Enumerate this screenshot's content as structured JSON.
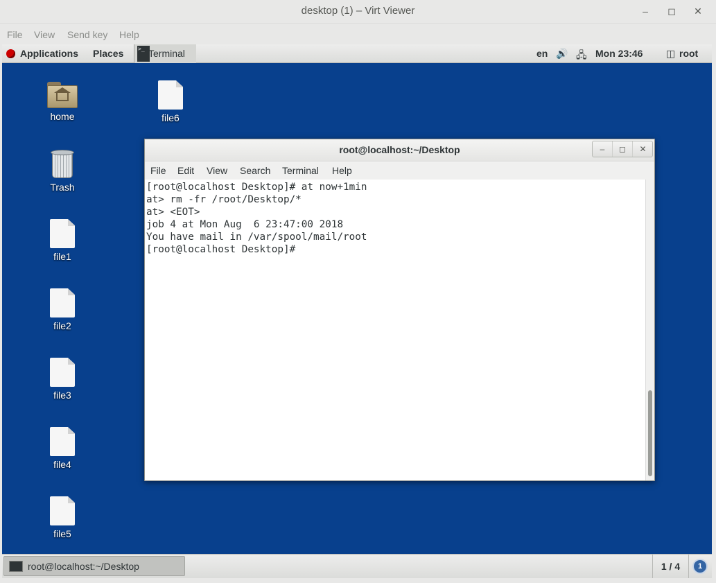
{
  "viewer": {
    "title": "desktop (1) – Virt Viewer",
    "menu": [
      "File",
      "View",
      "Send key",
      "Help"
    ]
  },
  "topbar": {
    "applications": "Applications",
    "places": "Places",
    "task": "Terminal",
    "language": "en",
    "clock": "Mon 23:46",
    "user": "root"
  },
  "desktop": {
    "icons": [
      {
        "label": "home",
        "type": "folder"
      },
      {
        "label": "Trash",
        "type": "trash"
      },
      {
        "label": "file1",
        "type": "file"
      },
      {
        "label": "file2",
        "type": "file"
      },
      {
        "label": "file3",
        "type": "file"
      },
      {
        "label": "file4",
        "type": "file"
      },
      {
        "label": "file5",
        "type": "file"
      },
      {
        "label": "file6",
        "type": "file"
      }
    ]
  },
  "terminal": {
    "title": "root@localhost:~/Desktop",
    "menu": [
      "File",
      "Edit",
      "View",
      "Search",
      "Terminal",
      "Help"
    ],
    "lines": [
      "[root@localhost Desktop]# at now+1min",
      "at> rm -fr /root/Desktop/*",
      "at> <EOT>",
      "job 4 at Mon Aug  6 23:47:00 2018",
      "You have mail in /var/spool/mail/root",
      "[root@localhost Desktop]# "
    ]
  },
  "bottombar": {
    "task_label": "root@localhost:~/Desktop",
    "workspace": "1 / 4",
    "notifications": "1"
  },
  "colors": {
    "desktop_bg": "#08408d",
    "panel_bg": "#e8e8e7",
    "badge": "#3465a4"
  }
}
